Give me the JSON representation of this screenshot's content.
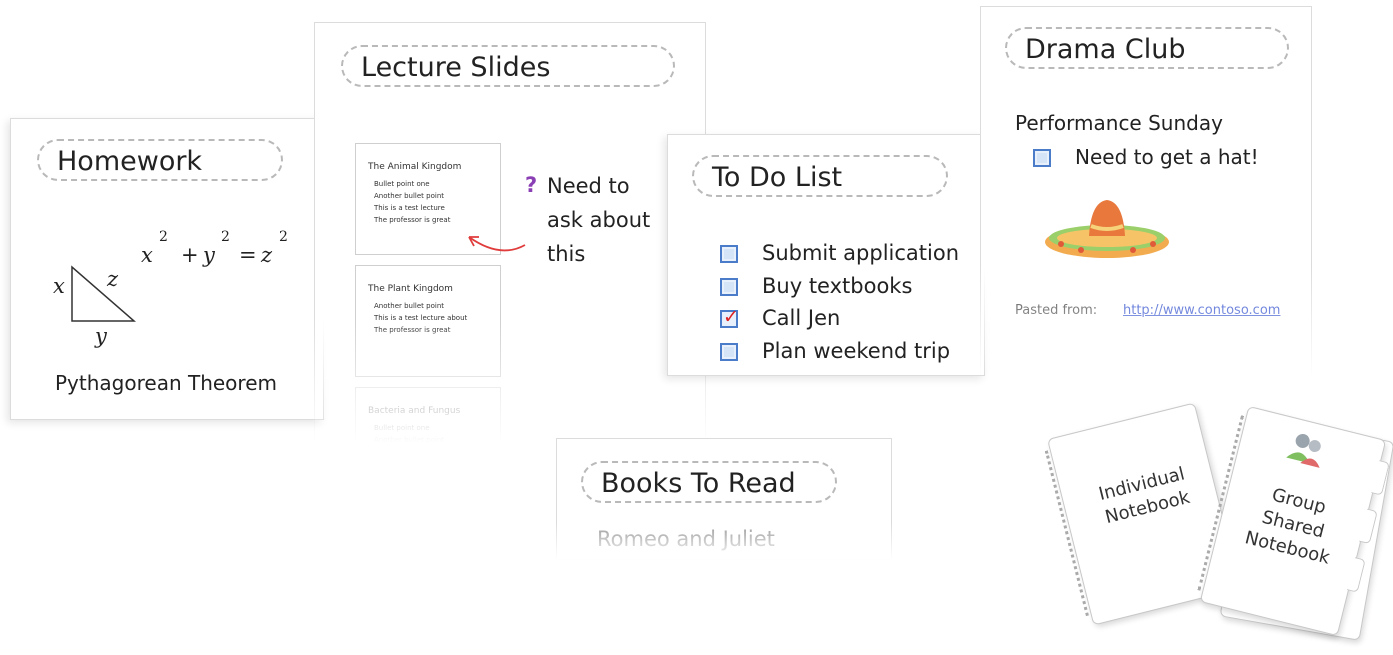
{
  "homework": {
    "title": "Homework",
    "caption": "Pythagorean Theorem",
    "tri_labels": {
      "x": "x",
      "z": "z",
      "y": "y"
    },
    "formula": {
      "a": "x",
      "b": "y",
      "c": "z",
      "exp": "2",
      "plus": "+",
      "eq": "="
    }
  },
  "lecture": {
    "title": "Lecture Slides",
    "note_lines": [
      "Need to",
      "ask about",
      "this"
    ],
    "note_icon": "?",
    "slides": [
      {
        "title": "The Animal Kingdom",
        "items": [
          "Bullet point one",
          "Another bullet point",
          "This is a test lecture",
          "The professor is great"
        ]
      },
      {
        "title": "The Plant Kingdom",
        "items": [
          "Another bullet point",
          "This is a test lecture about",
          "The professor is great"
        ]
      },
      {
        "title": "Bacteria and Fungus",
        "items": [
          "Bullet point one",
          "Another bullet point"
        ]
      }
    ]
  },
  "todo": {
    "title": "To Do List",
    "items": [
      {
        "label": "Submit application",
        "checked": false
      },
      {
        "label": "Buy textbooks",
        "checked": false
      },
      {
        "label": "Call Jen",
        "checked": true
      },
      {
        "label": "Plan weekend trip",
        "checked": false
      }
    ],
    "check_glyph": "✓"
  },
  "drama": {
    "title": "Drama Club",
    "heading": "Performance Sunday",
    "task": "Need to get a hat!",
    "pasted_label": "Pasted from:",
    "pasted_link": "http://www.contoso.com"
  },
  "books": {
    "title": "Books To Read",
    "first_item": "Romeo and Juliet"
  },
  "notebooks": {
    "individual": "Individual\nNotebook",
    "group": "Group\nShared\nNotebook"
  }
}
